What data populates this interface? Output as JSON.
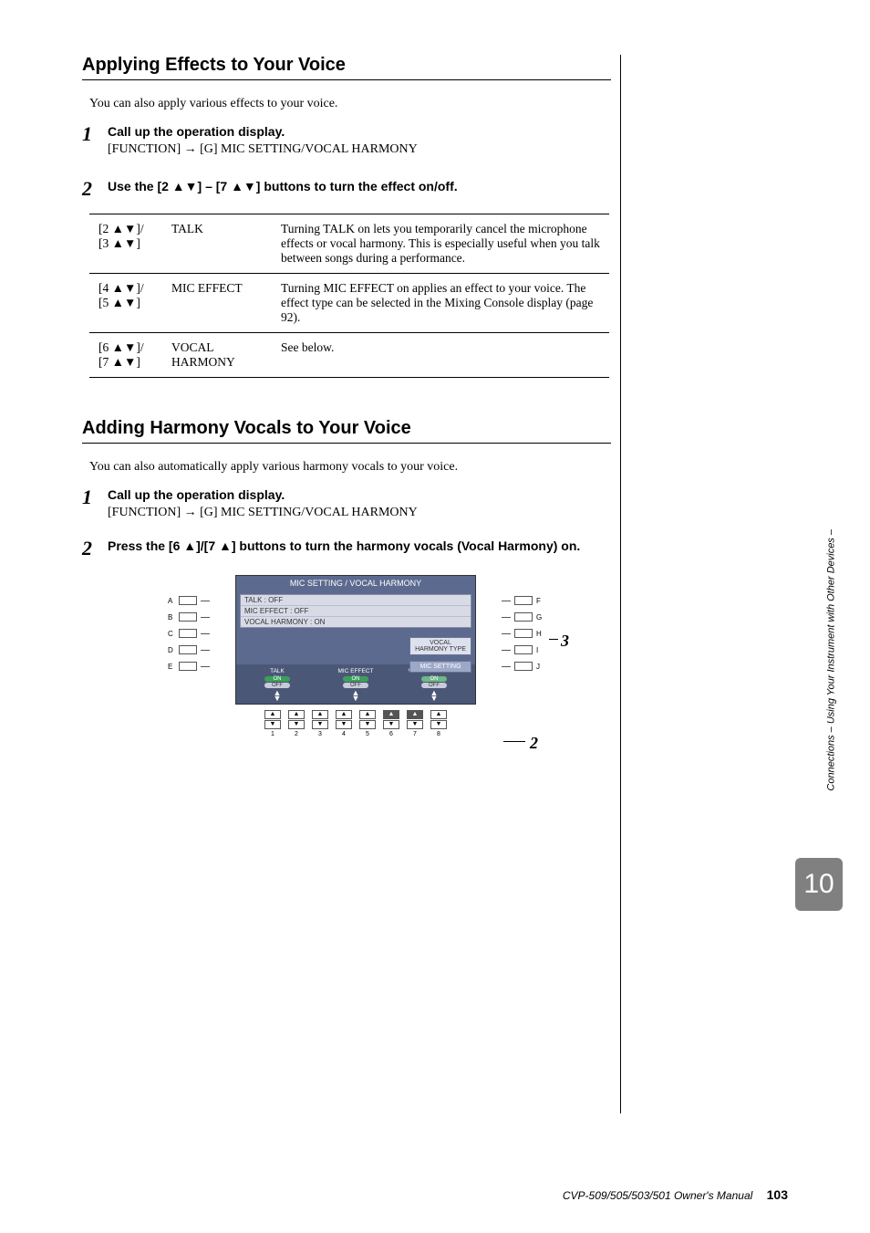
{
  "section1": {
    "title": "Applying Effects to Your Voice",
    "intro": "You can also apply various effects to your voice.",
    "step1": {
      "num": "1",
      "title": "Call up the operation display.",
      "text": "[FUNCTION] → [G] MIC SETTING/VOCAL HARMONY"
    },
    "step2": {
      "num": "2",
      "title": "Use the [2 ▲▼] – [7 ▲▼] buttons to turn the effect on/off."
    },
    "table": {
      "r1": {
        "c1": "[2 ▲▼]/\n[3 ▲▼]",
        "c2": "TALK",
        "c3": "Turning TALK on lets you temporarily cancel the microphone effects or vocal harmony. This is especially useful when you talk between songs during a performance."
      },
      "r2": {
        "c1": "[4 ▲▼]/\n[5 ▲▼]",
        "c2": "MIC EFFECT",
        "c3": "Turning MIC EFFECT on applies an effect to your voice. The effect type can be selected in the Mixing Console display (page 92)."
      },
      "r3": {
        "c1": "[6 ▲▼]/\n[7 ▲▼]",
        "c2": "VOCAL HARMONY",
        "c3": "See below."
      }
    }
  },
  "section2": {
    "title": "Adding Harmony Vocals to Your Voice",
    "intro": "You can also automatically apply various harmony vocals to your voice.",
    "step1": {
      "num": "1",
      "title": "Call up the operation display.",
      "text": "[FUNCTION] → [G] MIC SETTING/VOCAL HARMONY"
    },
    "step2": {
      "num": "2",
      "title": "Press the [6 ▲]/[7 ▲] buttons to turn the harmony vocals (Vocal Harmony) on."
    }
  },
  "display": {
    "title": "MIC SETTING / VOCAL HARMONY",
    "status": {
      "talk": "TALK : OFF",
      "mic": "MIC EFFECT : OFF",
      "vh": "VOCAL HARMONY : ON"
    },
    "rightBtn1": "VOCAL HARMONY TYPE",
    "rightBtn2": "MIC SETTING",
    "ctrl1": "TALK",
    "ctrl2": "MIC EFFECT",
    "ctrl3": "VOCAL HARMONY",
    "on": "ON",
    "off": "OFF",
    "sideLeft": [
      "A",
      "B",
      "C",
      "D",
      "E"
    ],
    "sideRight": [
      "F",
      "G",
      "H",
      "I",
      "J"
    ],
    "nums": [
      "1",
      "2",
      "3",
      "4",
      "5",
      "6",
      "7",
      "8"
    ],
    "callout3": "3",
    "callout2": "2"
  },
  "side": {
    "text": "Connections – Using Your Instrument with Other Devices –",
    "chapter": "10"
  },
  "footer": {
    "manual": "CVP-509/505/503/501 Owner's Manual",
    "page": "103"
  }
}
